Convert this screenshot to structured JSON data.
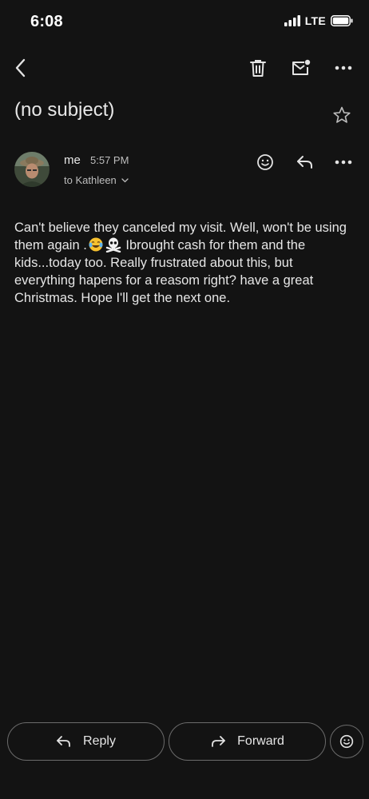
{
  "status_bar": {
    "time": "6:08",
    "network": "LTE"
  },
  "toolbar": {
    "back_icon": "chevron-left-icon",
    "delete_icon": "trash-icon",
    "mark_unread_icon": "mail-unread-icon",
    "more_icon": "more-horizontal-icon"
  },
  "email": {
    "subject": "(no subject)",
    "sender": "me",
    "time": "5:57 PM",
    "recipient": "to Kathleen",
    "body_parts": {
      "p1": "Can't believe they canceled my visit. Well, won't be using them again .",
      "p2": " Ibrought cash for them and the kids...today too. Really frustrated about this, but everything hapens for a reasom right? have a great Christmas. Hope I'll get the next one."
    }
  },
  "actions": {
    "reply_label": "Reply",
    "forward_label": "Forward"
  },
  "colors": {
    "background": "#131313",
    "text": "#e6e6e6",
    "muted": "#bdbdbd",
    "outline": "#6b6b6b"
  }
}
